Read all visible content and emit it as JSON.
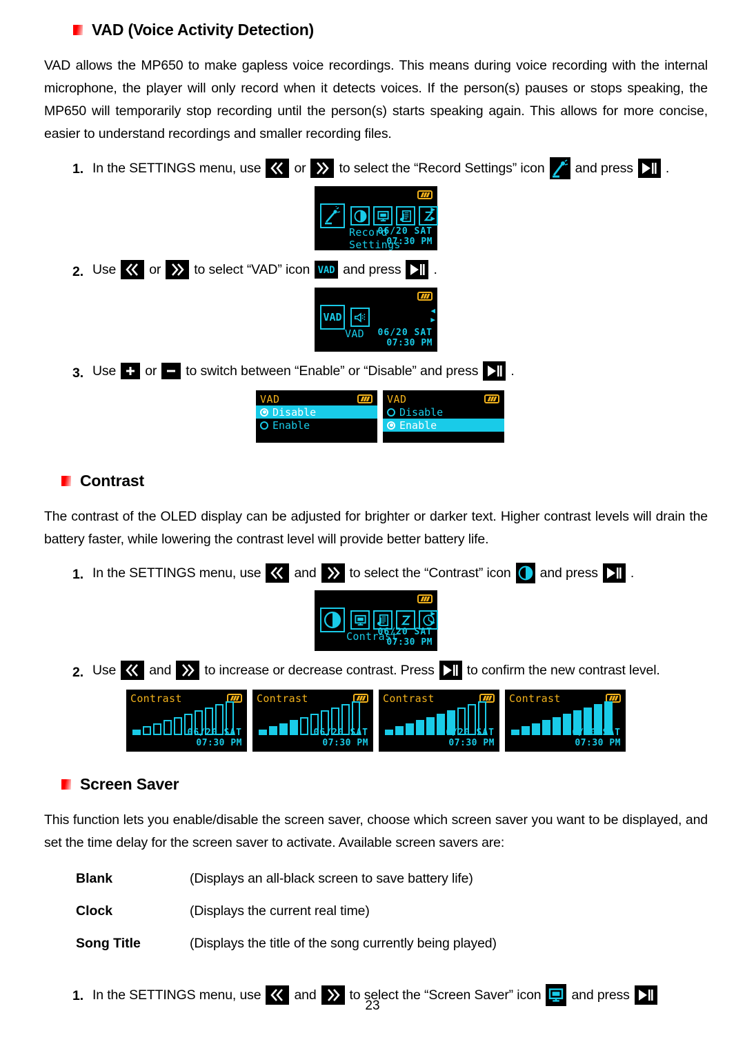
{
  "page": {
    "number": "23"
  },
  "sections": [
    {
      "id": "vad",
      "heading": "VAD (Voice Activity Detection)",
      "paragraph": "VAD allows the MP650 to make gapless voice recordings. This means during voice recording with the internal microphone, the player will only record when it detects voices. If the person(s) pauses or stops speaking, the MP650 will temporarily stop recording until the person(s) starts speaking again. This allows for more concise, easier to understand recordings and smaller recording files."
    },
    {
      "id": "contrast",
      "heading": "Contrast",
      "paragraph": "The contrast of the OLED display can be adjusted for brighter or darker text. Higher contrast levels will drain the battery faster, while lowering the contrast level will provide better battery life."
    },
    {
      "id": "screensaver",
      "heading": "Screen Saver",
      "paragraph": "This function lets you enable/disable the screen saver, choose which screen saver you want to be displayed, and set the time delay for the screen saver to activate.   Available screen savers are:"
    }
  ],
  "steps": {
    "vad1": {
      "num": "1.",
      "t1": "In the SETTINGS menu, use",
      "t2": "or",
      "t3": "to select the “Record Settings” icon",
      "t4": "and press",
      "t5": "."
    },
    "vad2": {
      "num": "2.",
      "t1": "Use",
      "t2": "or",
      "t3": "to select “VAD” icon",
      "t4": "and press",
      "t5": "."
    },
    "vad3": {
      "num": "3.",
      "t1": "Use",
      "t2": "or",
      "t3": "to switch between “Enable” or “Disable” and press",
      "t4": "."
    },
    "con1": {
      "num": "1.",
      "t1": "In the SETTINGS menu, use",
      "t2": "and",
      "t3": "to select the “Contrast” icon",
      "t4": "and press",
      "t5": "."
    },
    "con2": {
      "num": "2.",
      "t1": "Use",
      "t2": "and",
      "t3": "to increase or decrease contrast. Press",
      "t4": "to confirm the new contrast level."
    },
    "ss1": {
      "num": "1.",
      "t1": "In the SETTINGS menu, use",
      "t2": "and",
      "t3": "to select the “Screen Saver” icon",
      "t4": "and press"
    }
  },
  "screens": {
    "record_settings": {
      "label": "Record Settings",
      "date": "06/20 SAT",
      "time": "07:30 PM",
      "selected_icon": "record-microphone-icon",
      "icons": [
        "contrast-icon",
        "screen-saver-icon",
        "music-document-icon",
        "sleep-z-icon"
      ]
    },
    "vad_menu": {
      "label": "VAD",
      "date": "06/20 SAT",
      "time": "07:30 PM",
      "selected_icon": "vad-icon",
      "icons": [
        "speaker-icon"
      ]
    },
    "vad_disable": {
      "title": "VAD",
      "items": [
        {
          "label": "Disable",
          "selected": true
        },
        {
          "label": "Enable",
          "selected": false
        }
      ]
    },
    "vad_enable": {
      "title": "VAD",
      "items": [
        {
          "label": "Disable",
          "selected": false
        },
        {
          "label": "Enable",
          "selected": true
        }
      ]
    },
    "contrast_menu": {
      "label": "Contrast",
      "date": "06/20 SAT",
      "time": "07:30 PM",
      "selected_icon": "contrast-icon",
      "icons": [
        "screen-saver-icon",
        "music-document-icon",
        "sleep-z-icon",
        "clock-icon"
      ]
    },
    "contrast_levels": [
      {
        "title": "Contrast",
        "date": "06/20 SAT",
        "time": "07:30 PM",
        "filled": 1,
        "total": 10
      },
      {
        "title": "Contrast",
        "date": "06/20 SAT",
        "time": "07:30 PM",
        "filled": 4,
        "total": 10
      },
      {
        "title": "Contrast",
        "date": "06/20 SAT",
        "time": "07:30 PM",
        "filled": 7,
        "total": 10
      },
      {
        "title": "Contrast",
        "date": "06/20 SAT",
        "time": "07:30 PM",
        "filled": 10,
        "total": 10
      }
    ]
  },
  "screensaver_options": [
    {
      "term": "Blank",
      "desc": "(Displays an all-black screen to save battery life)"
    },
    {
      "term": "Clock",
      "desc": "(Displays the current real time)"
    },
    {
      "term": "Song Title",
      "desc": "(Displays the title of the song currently being played)"
    }
  ],
  "colors": {
    "bullet_red": "#ff0000",
    "oled_cyan": "#19cbe8",
    "oled_amber": "#f2b21c",
    "oled_bg": "#000000"
  }
}
